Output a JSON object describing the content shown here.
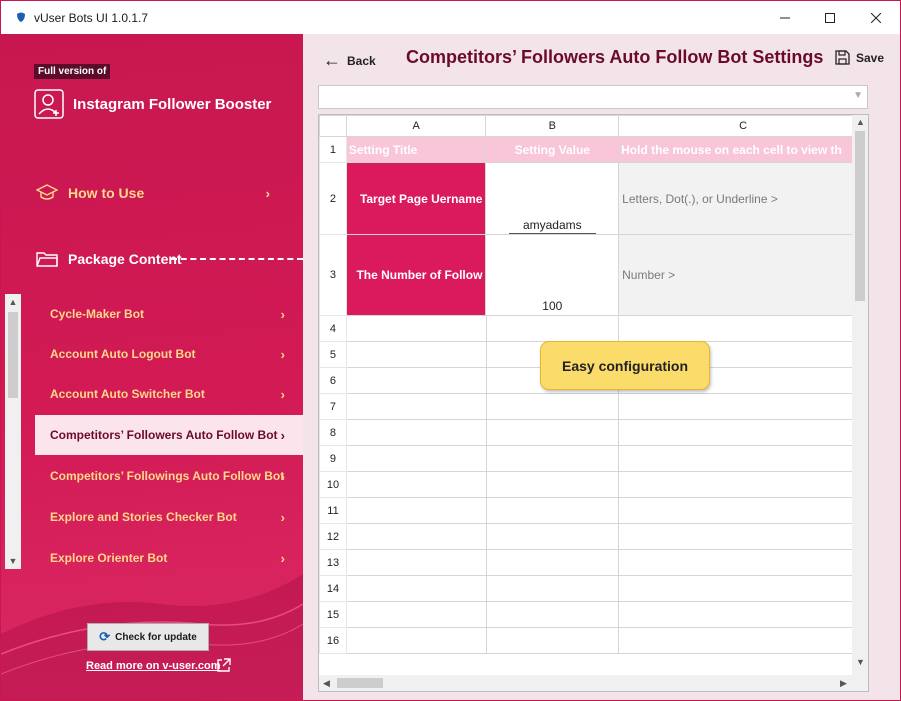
{
  "window": {
    "title": "vUser Bots UI 1.0.1.7",
    "controls": {
      "minimize": "—",
      "maximize": "☐",
      "close": "✕"
    }
  },
  "sidebar": {
    "badge": "Full version of",
    "app_name": "Instagram Follower Booster",
    "how_to_use": "How to Use",
    "package_content": "Package Content",
    "items": [
      {
        "label": "Cycle-Maker Bot"
      },
      {
        "label": "Account Auto Logout Bot"
      },
      {
        "label": "Account Auto Switcher Bot"
      },
      {
        "label": "Competitors’ Followers Auto Follow Bot"
      },
      {
        "label": "Competitors’ Followings Auto Follow Bot"
      },
      {
        "label": "Explore and Stories Checker Bot"
      },
      {
        "label": "Explore Orienter Bot"
      }
    ],
    "active_index": 3,
    "check_update": "Check for update",
    "read_more": "Read more on v-user.com",
    "colors": {
      "accent": "#c8174f",
      "menu_text": "#ffd88a",
      "active_bg": "#fbe4ec"
    }
  },
  "main": {
    "back": "Back",
    "title": "Competitors’ Followers Auto Follow Bot Settings",
    "save": "Save",
    "columns": [
      "A",
      "B",
      "C"
    ],
    "header": {
      "a": "Setting Title",
      "b": "Setting Value",
      "c": "Hold the mouse on each cell to view th"
    },
    "rows": [
      {
        "num": "2",
        "title": "Target Page Uername",
        "value": "amyadams",
        "hint": "Letters, Dot(.), or Underline >"
      },
      {
        "num": "3",
        "title": "The Number of Follow",
        "value": "100",
        "hint": "Number >"
      }
    ],
    "empty_rows": [
      "4",
      "5",
      "6",
      "7",
      "8",
      "9",
      "10",
      "11",
      "12",
      "13",
      "14",
      "15",
      "16"
    ],
    "tooltip": "Easy configuration",
    "colors": {
      "title": "#6b0a2d",
      "setting_cell": "#db1a5e",
      "header_row": "#f8c6d8",
      "tooltip": "#fbdc6a"
    }
  }
}
